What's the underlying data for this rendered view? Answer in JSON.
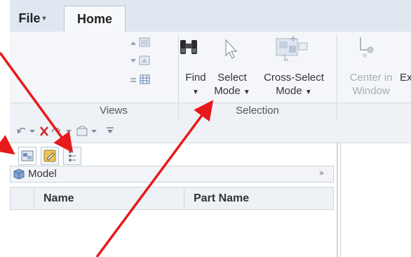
{
  "tabs": {
    "file_label": "File",
    "home_label": "Home"
  },
  "ribbon": {
    "find_label": "Find",
    "select_mode_line1": "Select",
    "select_mode_line2": "Mode",
    "cross_select_line1": "Cross-Select",
    "cross_select_line2": "Mode",
    "center_in_window_line1": "Center in",
    "center_in_window_line2": "Window",
    "ex_label": "Ex",
    "group_views": "Views",
    "group_selection": "Selection"
  },
  "panel": {
    "model_label": "Model",
    "columns": [
      "Name",
      "Part Name"
    ]
  },
  "colors": {
    "annotation_arrow": "#e8191a",
    "ribbon_bg": "#f4f6f9",
    "tab_strip_bg": "#dfe7f1"
  },
  "icons": {
    "qab": [
      "undo-icon",
      "redo-icon",
      "delete-icon",
      "open-icon"
    ],
    "panel_tabs": [
      "model-tree-icon",
      "edit-icon",
      "hierarchy-icon"
    ]
  }
}
